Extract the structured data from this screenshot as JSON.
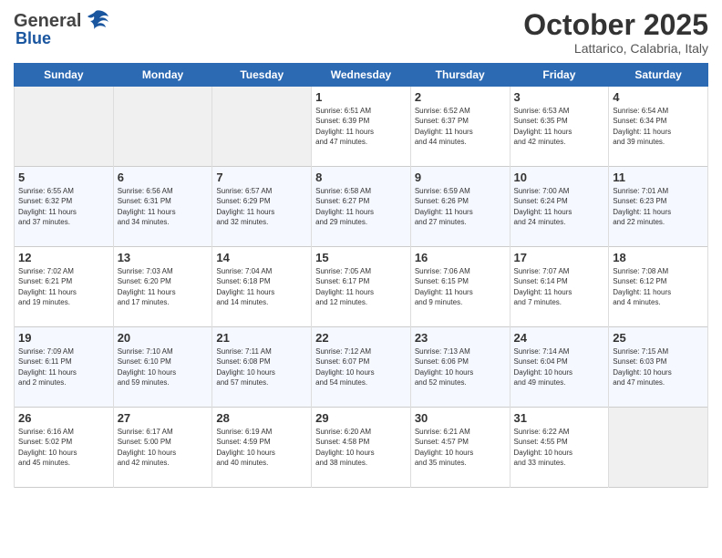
{
  "header": {
    "logo_general": "General",
    "logo_blue": "Blue",
    "month": "October 2025",
    "location": "Lattarico, Calabria, Italy"
  },
  "weekdays": [
    "Sunday",
    "Monday",
    "Tuesday",
    "Wednesday",
    "Thursday",
    "Friday",
    "Saturday"
  ],
  "weeks": [
    [
      {
        "day": "",
        "info": ""
      },
      {
        "day": "",
        "info": ""
      },
      {
        "day": "",
        "info": ""
      },
      {
        "day": "1",
        "info": "Sunrise: 6:51 AM\nSunset: 6:39 PM\nDaylight: 11 hours\nand 47 minutes."
      },
      {
        "day": "2",
        "info": "Sunrise: 6:52 AM\nSunset: 6:37 PM\nDaylight: 11 hours\nand 44 minutes."
      },
      {
        "day": "3",
        "info": "Sunrise: 6:53 AM\nSunset: 6:35 PM\nDaylight: 11 hours\nand 42 minutes."
      },
      {
        "day": "4",
        "info": "Sunrise: 6:54 AM\nSunset: 6:34 PM\nDaylight: 11 hours\nand 39 minutes."
      }
    ],
    [
      {
        "day": "5",
        "info": "Sunrise: 6:55 AM\nSunset: 6:32 PM\nDaylight: 11 hours\nand 37 minutes."
      },
      {
        "day": "6",
        "info": "Sunrise: 6:56 AM\nSunset: 6:31 PM\nDaylight: 11 hours\nand 34 minutes."
      },
      {
        "day": "7",
        "info": "Sunrise: 6:57 AM\nSunset: 6:29 PM\nDaylight: 11 hours\nand 32 minutes."
      },
      {
        "day": "8",
        "info": "Sunrise: 6:58 AM\nSunset: 6:27 PM\nDaylight: 11 hours\nand 29 minutes."
      },
      {
        "day": "9",
        "info": "Sunrise: 6:59 AM\nSunset: 6:26 PM\nDaylight: 11 hours\nand 27 minutes."
      },
      {
        "day": "10",
        "info": "Sunrise: 7:00 AM\nSunset: 6:24 PM\nDaylight: 11 hours\nand 24 minutes."
      },
      {
        "day": "11",
        "info": "Sunrise: 7:01 AM\nSunset: 6:23 PM\nDaylight: 11 hours\nand 22 minutes."
      }
    ],
    [
      {
        "day": "12",
        "info": "Sunrise: 7:02 AM\nSunset: 6:21 PM\nDaylight: 11 hours\nand 19 minutes."
      },
      {
        "day": "13",
        "info": "Sunrise: 7:03 AM\nSunset: 6:20 PM\nDaylight: 11 hours\nand 17 minutes."
      },
      {
        "day": "14",
        "info": "Sunrise: 7:04 AM\nSunset: 6:18 PM\nDaylight: 11 hours\nand 14 minutes."
      },
      {
        "day": "15",
        "info": "Sunrise: 7:05 AM\nSunset: 6:17 PM\nDaylight: 11 hours\nand 12 minutes."
      },
      {
        "day": "16",
        "info": "Sunrise: 7:06 AM\nSunset: 6:15 PM\nDaylight: 11 hours\nand 9 minutes."
      },
      {
        "day": "17",
        "info": "Sunrise: 7:07 AM\nSunset: 6:14 PM\nDaylight: 11 hours\nand 7 minutes."
      },
      {
        "day": "18",
        "info": "Sunrise: 7:08 AM\nSunset: 6:12 PM\nDaylight: 11 hours\nand 4 minutes."
      }
    ],
    [
      {
        "day": "19",
        "info": "Sunrise: 7:09 AM\nSunset: 6:11 PM\nDaylight: 11 hours\nand 2 minutes."
      },
      {
        "day": "20",
        "info": "Sunrise: 7:10 AM\nSunset: 6:10 PM\nDaylight: 10 hours\nand 59 minutes."
      },
      {
        "day": "21",
        "info": "Sunrise: 7:11 AM\nSunset: 6:08 PM\nDaylight: 10 hours\nand 57 minutes."
      },
      {
        "day": "22",
        "info": "Sunrise: 7:12 AM\nSunset: 6:07 PM\nDaylight: 10 hours\nand 54 minutes."
      },
      {
        "day": "23",
        "info": "Sunrise: 7:13 AM\nSunset: 6:06 PM\nDaylight: 10 hours\nand 52 minutes."
      },
      {
        "day": "24",
        "info": "Sunrise: 7:14 AM\nSunset: 6:04 PM\nDaylight: 10 hours\nand 49 minutes."
      },
      {
        "day": "25",
        "info": "Sunrise: 7:15 AM\nSunset: 6:03 PM\nDaylight: 10 hours\nand 47 minutes."
      }
    ],
    [
      {
        "day": "26",
        "info": "Sunrise: 6:16 AM\nSunset: 5:02 PM\nDaylight: 10 hours\nand 45 minutes."
      },
      {
        "day": "27",
        "info": "Sunrise: 6:17 AM\nSunset: 5:00 PM\nDaylight: 10 hours\nand 42 minutes."
      },
      {
        "day": "28",
        "info": "Sunrise: 6:19 AM\nSunset: 4:59 PM\nDaylight: 10 hours\nand 40 minutes."
      },
      {
        "day": "29",
        "info": "Sunrise: 6:20 AM\nSunset: 4:58 PM\nDaylight: 10 hours\nand 38 minutes."
      },
      {
        "day": "30",
        "info": "Sunrise: 6:21 AM\nSunset: 4:57 PM\nDaylight: 10 hours\nand 35 minutes."
      },
      {
        "day": "31",
        "info": "Sunrise: 6:22 AM\nSunset: 4:55 PM\nDaylight: 10 hours\nand 33 minutes."
      },
      {
        "day": "",
        "info": ""
      }
    ]
  ]
}
